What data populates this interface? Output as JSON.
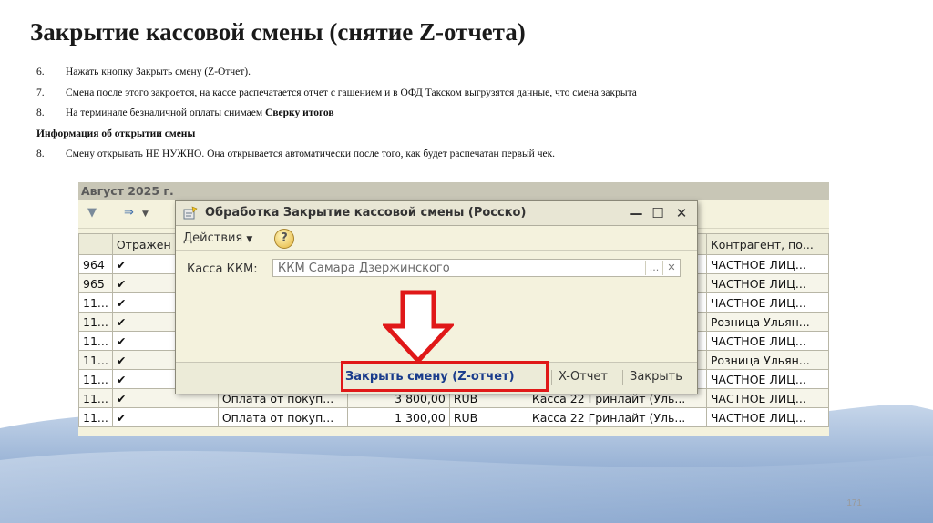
{
  "slide": {
    "title": "Закрытие кассовой смены (снятие Z-отчета)",
    "page_number": "171",
    "steps": [
      {
        "num": "6.",
        "text": "Нажать кнопку Закрыть смену (Z-Отчет)."
      },
      {
        "num": "7.",
        "text": "Смена после этого закроется, на кассе распечатается отчет с гашением и в ОФД Такском выгрузятся данные, что смена закрыта"
      },
      {
        "num": "8.",
        "text_prefix": "На терминале безналичной оплаты снимаем ",
        "text_bold": "Сверку итогов"
      }
    ],
    "subheading": "Информация об открытии смены",
    "step_after": {
      "num": "8.",
      "text": "Смену открывать НЕ НУЖНО. Она открывается автоматически после того, как будет распечатан первый чек."
    }
  },
  "background_window": {
    "title": "Август 2025 г.",
    "columns": [
      "",
      "Отражен",
      "",
      "",
      "",
      "",
      "Контрагент, по..."
    ],
    "rows": [
      {
        "c0": "964",
        "c1": "✔",
        "c2": "",
        "c3": "",
        "c4": "",
        "c5": "",
        "c6": "ЧАСТНОЕ ЛИЦ..."
      },
      {
        "c0": "965",
        "c1": "✔",
        "c2": "",
        "c3": "",
        "c4": "",
        "c5": "",
        "c6": "ЧАСТНОЕ ЛИЦ..."
      },
      {
        "c0": "11...",
        "c1": "✔",
        "c2": "",
        "c3": "",
        "c4": "",
        "c5": "",
        "c6": "ЧАСТНОЕ ЛИЦ..."
      },
      {
        "c0": "11...",
        "c1": "✔",
        "c2": "",
        "c3": "",
        "c4": "",
        "c5": "",
        "c6": "Розница Ульян..."
      },
      {
        "c0": "11...",
        "c1": "✔",
        "c2": "",
        "c3": "",
        "c4": "",
        "c5": "",
        "c6": "ЧАСТНОЕ ЛИЦ..."
      },
      {
        "c0": "11...",
        "c1": "✔",
        "c2": "",
        "c3": "",
        "c4": "",
        "c5": "",
        "c6": "Розница Ульян..."
      },
      {
        "c0": "11...",
        "c1": "✔",
        "c2": "",
        "c3": "",
        "c4": "",
        "c5": "",
        "c6": "ЧАСТНОЕ ЛИЦ..."
      },
      {
        "c0": "11...",
        "c1": "✔",
        "c2": "Оплата от покуп...",
        "c3": "3 800,00",
        "c4": "RUB",
        "c5": "Касса 22 Гринлайт (Уль...",
        "c6": "ЧАСТНОЕ ЛИЦ..."
      },
      {
        "c0": "11...",
        "c1": "✔",
        "c2": "Оплата от покуп...",
        "c3": "1 300,00",
        "c4": "RUB",
        "c5": "Касса 22 Гринлайт (Уль...",
        "c6": "ЧАСТНОЕ ЛИЦ..."
      }
    ]
  },
  "dialog": {
    "title": "Обработка  Закрытие кассовой смены (Росско)",
    "actions_label": "Действия",
    "help_label": "?",
    "kassa_label": "Касса ККМ:",
    "kassa_value": "ККМ Самара Дзержинского",
    "btn_close_shift": "Закрыть смену (Z-отчет)",
    "btn_x_report": "X-Отчет",
    "btn_close": "Закрыть",
    "win_min": "—",
    "win_max": "☐",
    "win_close": "✕"
  },
  "colors": {
    "highlight": "#e01818",
    "accent_blue": "#1a3c8c"
  },
  "icons": [
    "filter-icon",
    "export-icon",
    "dialog-icon",
    "help-icon",
    "down-arrow-icon"
  ]
}
